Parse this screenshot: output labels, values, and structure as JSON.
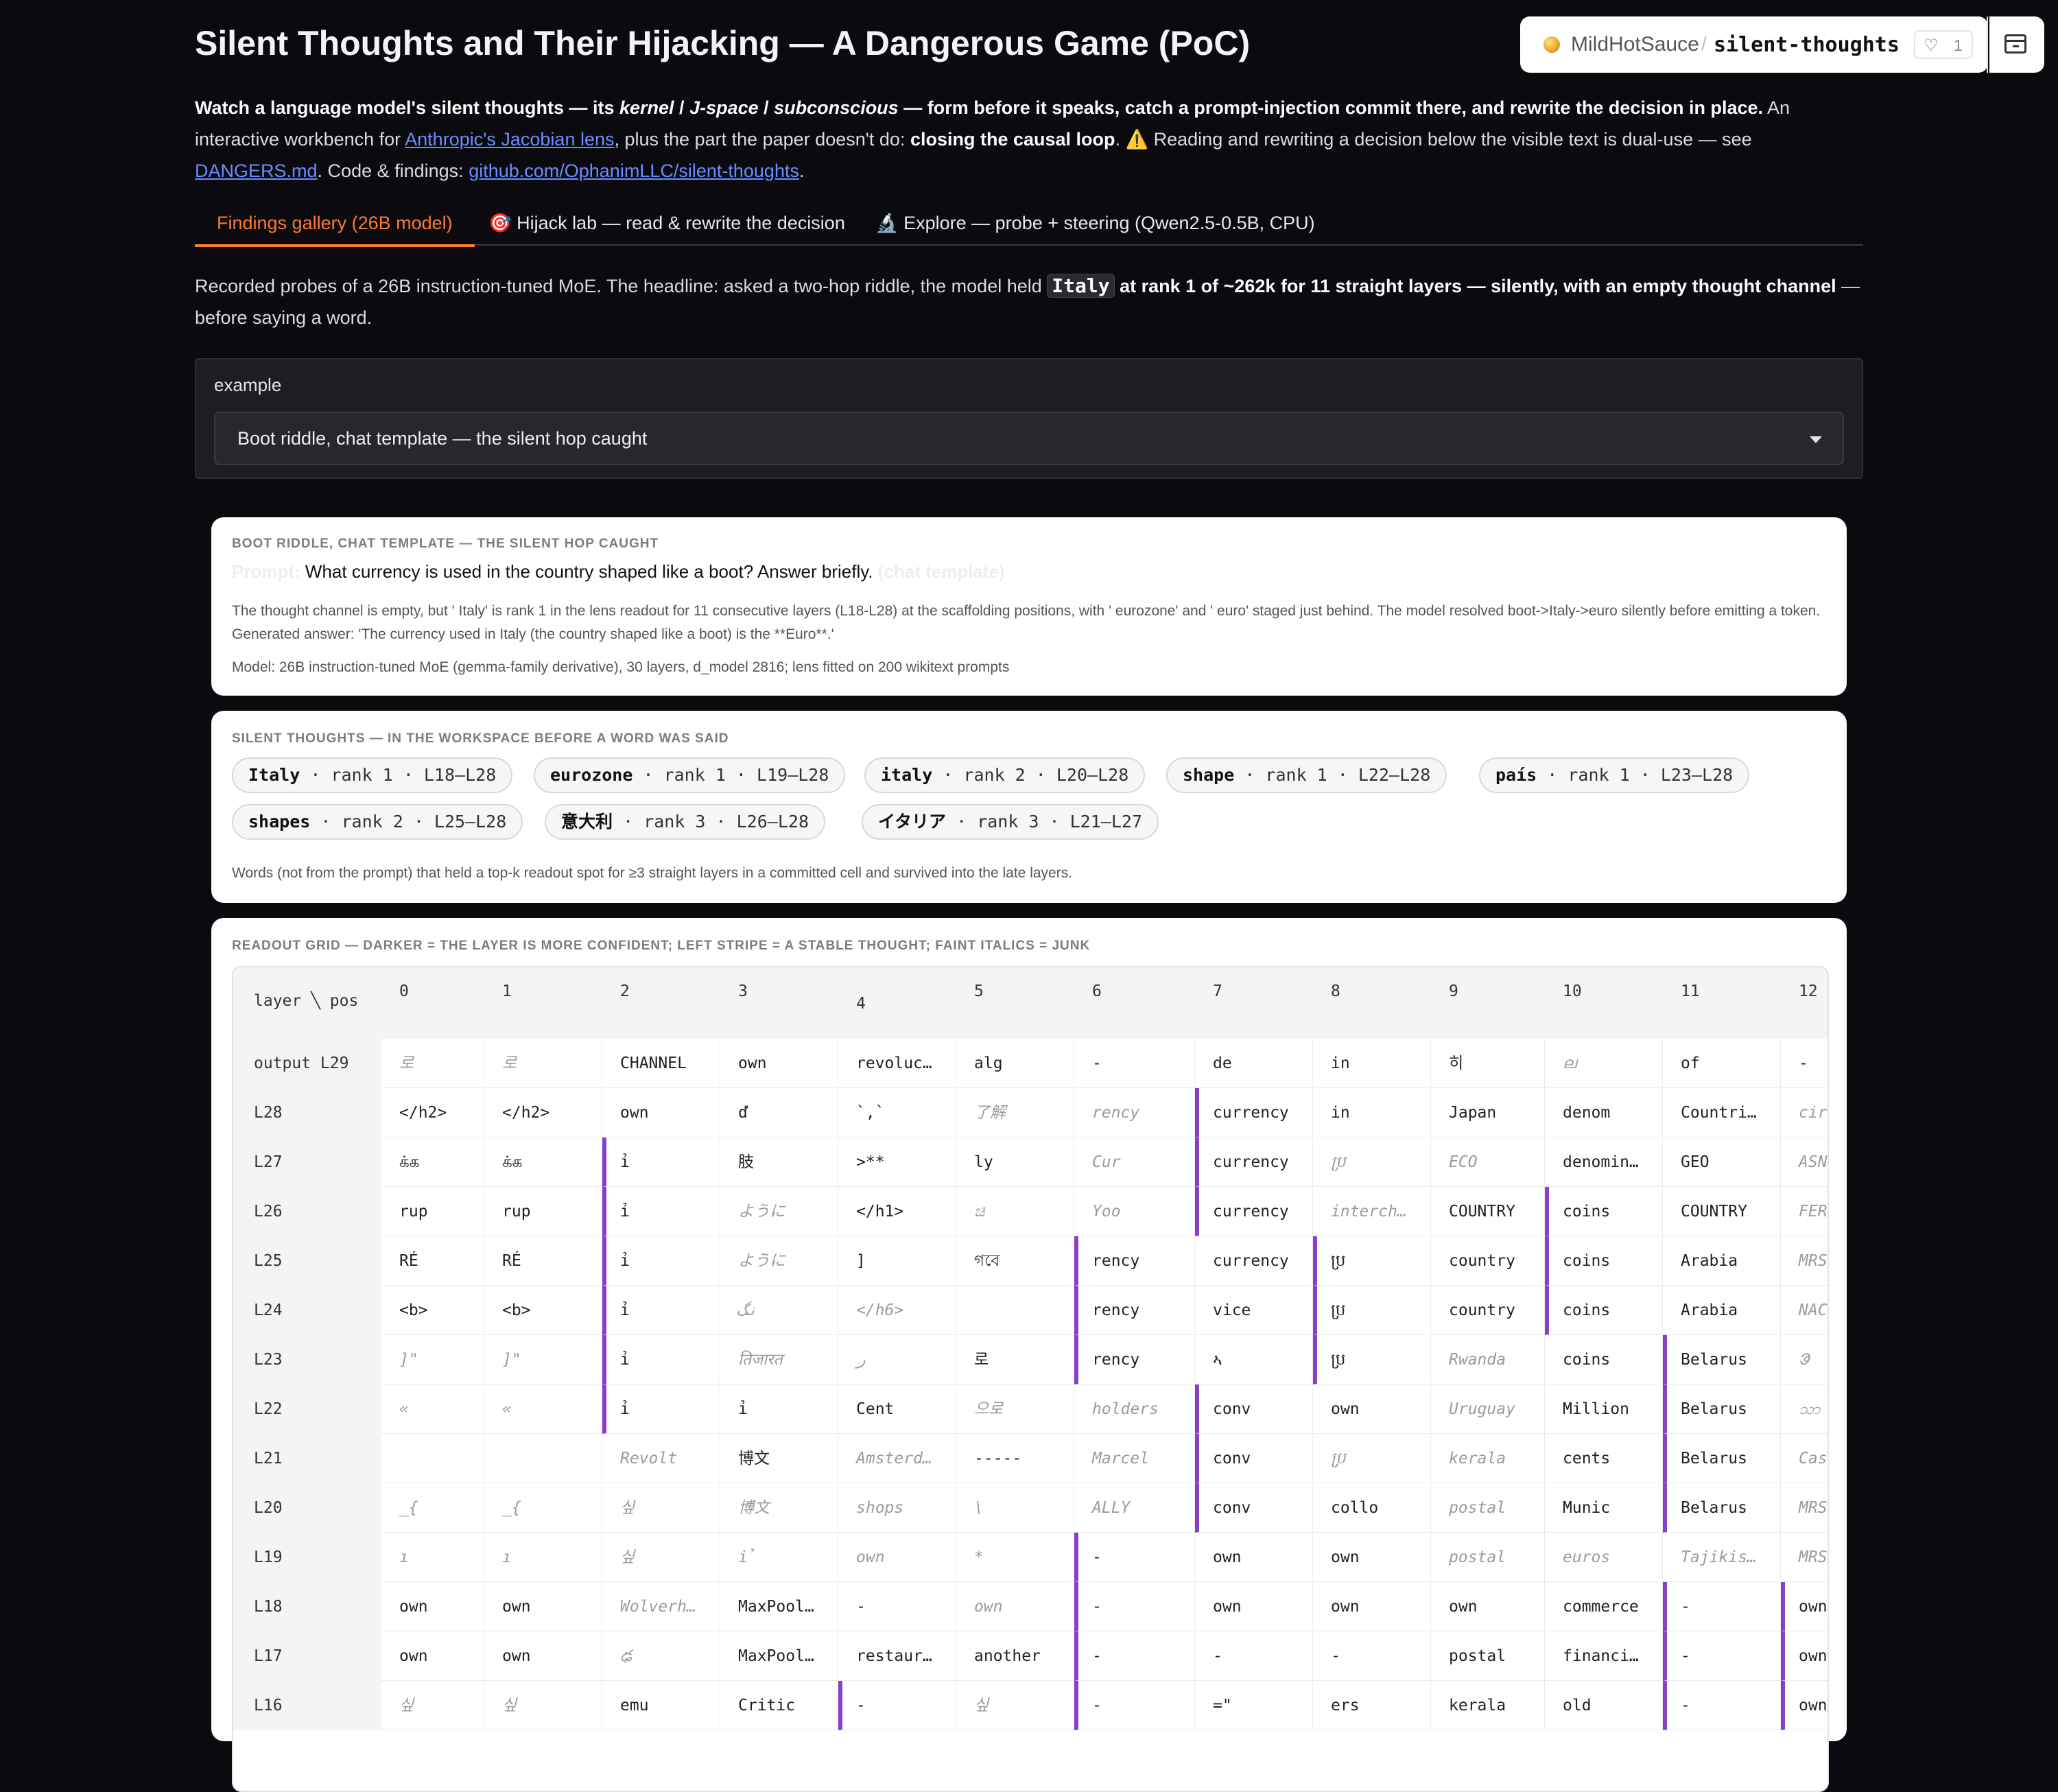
{
  "header": {
    "title": "Silent Thoughts and Their Hijacking — A Dangerous Game (PoC)",
    "owner": "MildHotSauce",
    "separator": "/",
    "repo": "silent-thoughts",
    "likes": "1"
  },
  "intro": {
    "bold1": "Watch a language model's silent thoughts — its ",
    "kernel": "kernel",
    "sep1": " / ",
    "jspace": "J-space",
    "sep2": " / ",
    "subconscious": "subconscious",
    "bold2": " — form before it speaks, catch a prompt-injection commit there, and rewrite the decision in place.",
    "t1": " An interactive workbench for ",
    "link1": "Anthropic's Jacobian lens",
    "t2": ", plus the part the paper doesn't do: ",
    "bold3": "closing the causal loop",
    "t3": ". ⚠️ Reading and rewriting a decision below the visible text is dual-use — see ",
    "link2": "DANGERS.md",
    "t4": ". Code & findings: ",
    "link3": "github.com/OphanimLLC/silent-thoughts",
    "t5": "."
  },
  "tabs": [
    {
      "label": "Findings gallery (26B model)",
      "active": true
    },
    {
      "label": "🎯 Hijack lab — read & rewrite the decision",
      "active": false
    },
    {
      "label": "🔬 Explore — probe + steering (Qwen2.5-0.5B, CPU)",
      "active": false
    }
  ],
  "lead": {
    "t1": "Recorded probes of a 26B instruction-tuned MoE. The headline: asked a two-hop riddle, the model held ",
    "code": "Italy",
    "bold": " at rank 1 of ~262k for 11 straight layers — silently, with an empty thought channel",
    "t2": " — before saying a word."
  },
  "selector": {
    "label": "example",
    "value": "Boot riddle, chat template — the silent hop caught"
  },
  "example_card": {
    "heading": "Boot riddle, chat template — the silent hop caught",
    "prompt_label": "Prompt:",
    "prompt": "What currency is used in the country shaped like a boot? Answer briefly.",
    "prompt_tag": "(chat template)",
    "description": "The thought channel is empty, but ' Italy' is rank 1 in the lens readout for 11 consecutive layers (L18-L28) at the scaffolding positions, with ' eurozone' and ' euro' staged just behind. The model resolved boot->Italy->euro silently before emitting a token. Generated answer: 'The currency used in Italy (the country shaped like a boot) is the **Euro**.'",
    "model": "Model: 26B instruction-tuned MoE (gemma-family derivative), 30 layers, d_model 2816; lens fitted on 200 wikitext prompts"
  },
  "thoughts_card": {
    "heading": "Silent thoughts — in the workspace before a word was said",
    "chips": [
      {
        "word": "Italy",
        "meta": " · rank 1 · L18–L28"
      },
      {
        "word": "eurozone",
        "meta": " · rank 1 · L19–L28"
      },
      {
        "word": "italy",
        "meta": " · rank 2 · L20–L28"
      },
      {
        "word": "shape",
        "meta": " · rank 1 · L22–L28"
      },
      {
        "word": "país",
        "meta": " · rank 1 · L23–L28"
      },
      {
        "word": "shapes",
        "meta": " · rank 2 · L25–L28"
      },
      {
        "word": "意大利",
        "meta": " · rank 3 · L26–L28"
      },
      {
        "word": "イタリア",
        "meta": " · rank 3 · L21–L27"
      }
    ],
    "footnote": "Words (not from the prompt) that held a top-k readout spot for ≥3 straight layers in a committed cell and survived into the late layers."
  },
  "grid_card": {
    "heading": "Readout grid — darker = the layer is more confident; left stripe = a stable thought; faint italics = junk",
    "corner": "layer ╲ pos",
    "positions": [
      "0",
      "1",
      "2",
      "3",
      "4",
      "5",
      "6",
      "7",
      "8",
      "9",
      "10",
      "11",
      "12"
    ],
    "rows": [
      {
        "layer": "output L29",
        "cells": [
          [
            "로",
            "j"
          ],
          [
            "로",
            "j"
          ],
          [
            "CHANNEL",
            ""
          ],
          [
            "own",
            ""
          ],
          [
            "revoluc…",
            ""
          ],
          [
            "alg",
            ""
          ],
          [
            "-",
            ""
          ],
          [
            "de",
            ""
          ],
          [
            "in",
            ""
          ],
          [
            "히",
            ""
          ],
          [
            "ല",
            "j"
          ],
          [
            "of",
            ""
          ],
          [
            "-",
            ""
          ]
        ]
      },
      {
        "layer": "L28",
        "cells": [
          [
            "</h2>",
            ""
          ],
          [
            "</h2>",
            ""
          ],
          [
            "own",
            ""
          ],
          [
            "ď",
            ""
          ],
          [
            "`,`",
            ""
          ],
          [
            "了解",
            "j"
          ],
          [
            "rency",
            "j"
          ],
          [
            "currency",
            "s"
          ],
          [
            "in",
            ""
          ],
          [
            "Japan",
            ""
          ],
          [
            "denom",
            ""
          ],
          [
            "Countri…",
            ""
          ],
          [
            "circu",
            "j"
          ]
        ]
      },
      {
        "layer": "L27",
        "cells": [
          [
            "க்க",
            ""
          ],
          [
            "க்க",
            ""
          ],
          [
            "ỉ",
            "s"
          ],
          [
            "肢",
            ""
          ],
          [
            ">**",
            ""
          ],
          [
            "ly",
            ""
          ],
          [
            "Cur",
            "j"
          ],
          [
            "currency",
            "s"
          ],
          [
            "ប្រ",
            "j"
          ],
          [
            "ECO",
            "j"
          ],
          [
            "denomin…",
            ""
          ],
          [
            "GEO",
            ""
          ],
          [
            "ASN",
            "j"
          ]
        ]
      },
      {
        "layer": "L26",
        "cells": [
          [
            "rup",
            ""
          ],
          [
            "rup",
            ""
          ],
          [
            "ỉ",
            "s"
          ],
          [
            "ように",
            "j"
          ],
          [
            "</h1>",
            ""
          ],
          [
            "ಚಿ",
            "j"
          ],
          [
            "Yoo",
            "j"
          ],
          [
            "currency",
            "s"
          ],
          [
            "interch…",
            "j"
          ],
          [
            "COUNTRY",
            ""
          ],
          [
            "coins",
            "s"
          ],
          [
            "COUNTRY",
            ""
          ],
          [
            "FERN",
            "j"
          ]
        ]
      },
      {
        "layer": "L25",
        "cells": [
          [
            "RÉ",
            ""
          ],
          [
            "RÉ",
            ""
          ],
          [
            "ỉ",
            "s"
          ],
          [
            "ように",
            "j"
          ],
          [
            "]",
            ""
          ],
          [
            "গবে",
            ""
          ],
          [
            "rency",
            "s"
          ],
          [
            "currency",
            ""
          ],
          [
            "ប្រ",
            "s"
          ],
          [
            "country",
            ""
          ],
          [
            "coins",
            "s"
          ],
          [
            "Arabia",
            ""
          ],
          [
            "MRS",
            "j"
          ]
        ]
      },
      {
        "layer": "L24",
        "cells": [
          [
            "<b>",
            ""
          ],
          [
            "<b>",
            ""
          ],
          [
            "ỉ",
            "s"
          ],
          [
            "نگ",
            "j"
          ],
          [
            "</h6>",
            "j"
          ],
          [
            "",
            ""
          ],
          [
            "rency",
            "s"
          ],
          [
            "vice",
            ""
          ],
          [
            "ប្រ",
            "s"
          ],
          [
            "country",
            ""
          ],
          [
            "coins",
            "s"
          ],
          [
            "Arabia",
            ""
          ],
          [
            "NAC",
            "j"
          ]
        ]
      },
      {
        "layer": "L23",
        "cells": [
          [
            "]\"",
            "j"
          ],
          [
            "]\"",
            "j"
          ],
          [
            "ỉ",
            "s"
          ],
          [
            "तिजारत",
            "j"
          ],
          [
            "ﺭ",
            "j"
          ],
          [
            "로",
            ""
          ],
          [
            "rency",
            "s"
          ],
          [
            "ኣ",
            ""
          ],
          [
            "ប្រ",
            "s"
          ],
          [
            "Rwanda",
            "j"
          ],
          [
            "coins",
            ""
          ],
          [
            "Belarus",
            "s"
          ],
          [
            "ᱳ",
            "j"
          ]
        ]
      },
      {
        "layer": "L22",
        "cells": [
          [
            "«",
            "j"
          ],
          [
            "«",
            "j"
          ],
          [
            "ỉ",
            "s"
          ],
          [
            "ỉ",
            ""
          ],
          [
            "Cent",
            ""
          ],
          [
            "으로",
            "j"
          ],
          [
            "holders",
            "j"
          ],
          [
            "conv",
            "s"
          ],
          [
            "own",
            ""
          ],
          [
            "Uruguay",
            "j"
          ],
          [
            "Million",
            ""
          ],
          [
            "Belarus",
            "s"
          ],
          [
            "သာ",
            "j"
          ]
        ]
      },
      {
        "layer": "L21",
        "cells": [
          [
            "",
            ""
          ],
          [
            "",
            ""
          ],
          [
            "Revolt",
            "j"
          ],
          [
            "博文",
            ""
          ],
          [
            "Amsterd…",
            "j"
          ],
          [
            "-----",
            ""
          ],
          [
            "Marcel",
            "j"
          ],
          [
            "conv",
            "s"
          ],
          [
            "ប្រ",
            "j"
          ],
          [
            "kerala",
            "j"
          ],
          [
            "cents",
            ""
          ],
          [
            "Belarus",
            "s"
          ],
          [
            "Cassi",
            "j"
          ]
        ]
      },
      {
        "layer": "L20",
        "cells": [
          [
            "_{",
            "j"
          ],
          [
            "_{",
            "j"
          ],
          [
            "싶",
            "j"
          ],
          [
            "博文",
            "j"
          ],
          [
            "shops",
            "j"
          ],
          [
            "\\",
            "j"
          ],
          [
            "ALLY",
            "j"
          ],
          [
            "conv",
            "s"
          ],
          [
            "collo",
            ""
          ],
          [
            "postal",
            "j"
          ],
          [
            "Munic",
            ""
          ],
          [
            "Belarus",
            "s"
          ],
          [
            "MRS",
            "j"
          ]
        ]
      },
      {
        "layer": "L19",
        "cells": [
          [
            "ı",
            "j"
          ],
          [
            "ı",
            "j"
          ],
          [
            "싶",
            "j"
          ],
          [
            "ỉ",
            "j"
          ],
          [
            "own",
            "j"
          ],
          [
            "*",
            "j"
          ],
          [
            "-",
            "s"
          ],
          [
            "own",
            ""
          ],
          [
            "own",
            ""
          ],
          [
            "postal",
            "j"
          ],
          [
            "euros",
            "j"
          ],
          [
            "Tajikis…",
            "j"
          ],
          [
            "MRS",
            "j"
          ]
        ]
      },
      {
        "layer": "L18",
        "cells": [
          [
            "own",
            ""
          ],
          [
            "own",
            ""
          ],
          [
            "Wolverh…",
            "j"
          ],
          [
            "MaxPool…",
            ""
          ],
          [
            "-",
            ""
          ],
          [
            "own",
            "j"
          ],
          [
            "-",
            "s"
          ],
          [
            "own",
            ""
          ],
          [
            "own",
            ""
          ],
          [
            "own",
            ""
          ],
          [
            "commerce",
            ""
          ],
          [
            "-",
            "s"
          ],
          [
            "own",
            "s"
          ]
        ]
      },
      {
        "layer": "L17",
        "cells": [
          [
            "own",
            ""
          ],
          [
            "own",
            ""
          ],
          [
            "ఢ",
            "j"
          ],
          [
            "MaxPool…",
            ""
          ],
          [
            "restaur…",
            ""
          ],
          [
            "another",
            ""
          ],
          [
            "-",
            "s"
          ],
          [
            "-",
            ""
          ],
          [
            "-",
            ""
          ],
          [
            "postal",
            ""
          ],
          [
            "financi…",
            ""
          ],
          [
            "-",
            "s"
          ],
          [
            "own",
            "s"
          ]
        ]
      },
      {
        "layer": "L16",
        "cells": [
          [
            "싶",
            "j"
          ],
          [
            "싶",
            "j"
          ],
          [
            "emu",
            ""
          ],
          [
            "Critic",
            ""
          ],
          [
            "-",
            "s"
          ],
          [
            "싶",
            "j"
          ],
          [
            "-",
            "s"
          ],
          [
            "=\"",
            ""
          ],
          [
            "ers",
            ""
          ],
          [
            "kerala",
            ""
          ],
          [
            "old",
            ""
          ],
          [
            "-",
            "s"
          ],
          [
            "own",
            "s"
          ]
        ]
      }
    ]
  },
  "colors": {
    "accent": "#ff7a2f",
    "link": "#6b8cff",
    "stripe": "#8a3fc8",
    "background": "#0b0b0f"
  }
}
